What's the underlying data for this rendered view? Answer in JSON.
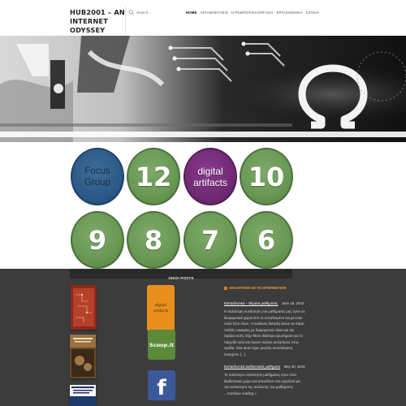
{
  "header": {
    "site_title": "HUB2001 – AN INTERNET ODYSSEY",
    "search_placeholder": "Search ..."
  },
  "nav": {
    "items": [
      "HOME",
      "ΑΣΤΑΘΟΚΥΛΕΙΣ",
      "Η ΡΟΜΠΟΤΙΚΗ ΕΡΓΑΣΙΑ",
      "ΕΡΓΑΣΙΟΘΗΚΗ",
      "ΣΧΟΛΙΑ"
    ],
    "active_index": 0
  },
  "circles": [
    {
      "label": "Focus Group",
      "color": "#2c5a88"
    },
    {
      "label": "12",
      "color": "#6a9a55"
    },
    {
      "label": "digital artifacts",
      "color": "#702a74"
    },
    {
      "label": "10",
      "color": "#6a9a55"
    },
    {
      "label": "9",
      "color": "#6a9a55"
    },
    {
      "label": "8",
      "color": "#6a9a55"
    },
    {
      "label": "7",
      "color": "#6a9a55"
    },
    {
      "label": "6",
      "color": "#6a9a55"
    }
  ],
  "footer": {
    "widget_title": "ΟΙΚΟΙ POSTS",
    "badges": {
      "digital_artifacts": "digital artifacts",
      "scoopit": "Scoop.it",
      "facebook": "f"
    },
    "posts_heading": "ΑΝΑΖΗΤΗΣΗ ΣΕ ΤΟ INTERNETΙΟΝ",
    "post1_title": "Εκπαιδευτικά – Θέματα μαθήματος",
    "post1_date": "June 15, 2016",
    "post1_excerpt": "Η παλιότερη συνάντηση του μαθήματος μας έγινε σε διαφορετικά χώρα από το συνηθισμένο και με έναν πολύ ξένο όλων. Η ανάλυση διάταξη έκανε να πάρει πολλές ευκαιρίες με διαφορετικό υλικό και την Σφαίρα αυτή. Είχε θέσει ιδιαίτερα ερωτήματα για το παιχνίδι αυτό και έγιναν πολλές συζητήσεις στην ομάδα. Όλα αυτά είχαν μεγάλη ανταπόκριση.",
    "post1_more": "Συνεχίστε [...]",
    "post2_title": "Εκπαιδευτικά Διαδικτυακά μαθήματα",
    "post2_date": "May 30, 2016",
    "post2_excerpt": "Το παλιότερο συνάντηση μαθήματος έγινε στον διαδικτυακό χώρο και αποτέλεσε ένα εργαλείο για την κατανόηση της ανάλυσης του μαθήματος.",
    "continue_reading": "...Continue reading »"
  },
  "colors": {
    "accent": "#f0a040",
    "footer_bg": "#3c3c3c",
    "green": "#6a9a55",
    "blue": "#2c5a88",
    "purple": "#702a74"
  },
  "icons": {
    "search": "search-icon",
    "omega": "omega-symbol",
    "facebook": "facebook-icon",
    "scoopit": "scoopit-icon"
  }
}
